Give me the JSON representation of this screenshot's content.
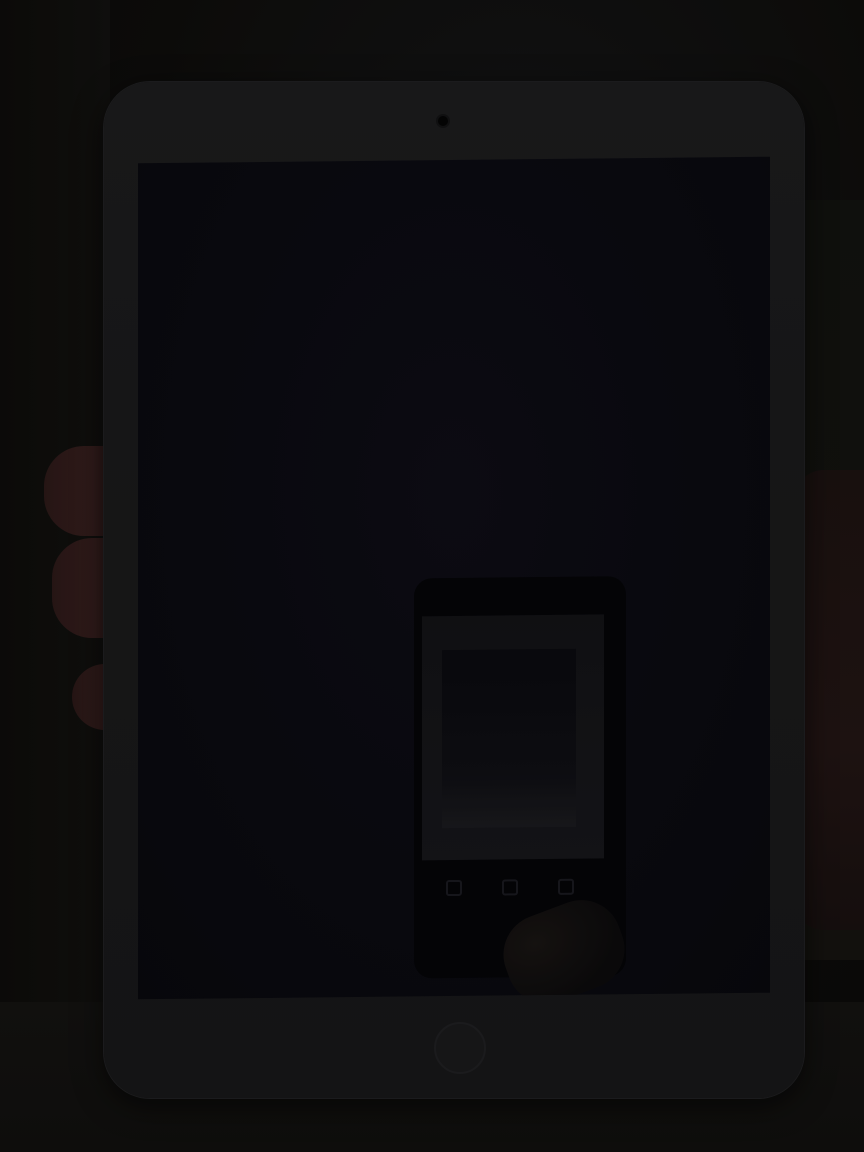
{
  "scene": {
    "description_tag": "",
    "colors": {
      "background": "#0d0c0a",
      "tablet_bezel": "#1c1c1d",
      "screen": "#0b0b12",
      "finger": "#3a2120"
    }
  }
}
